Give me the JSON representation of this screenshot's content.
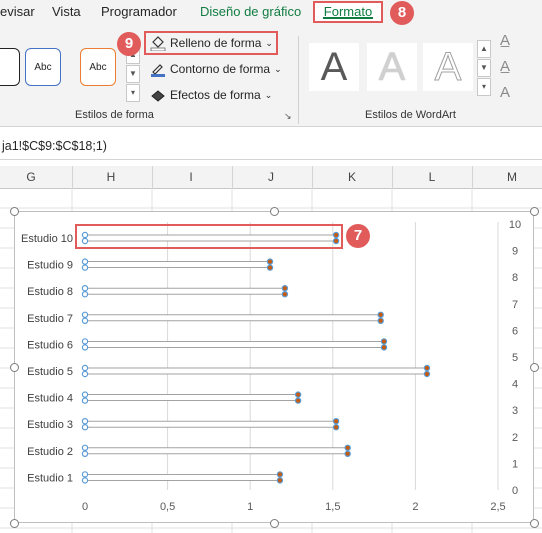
{
  "ribbon": {
    "tabs": [
      {
        "label": "evisar",
        "x": 0
      },
      {
        "label": "Vista",
        "x": 52
      },
      {
        "label": "Programador",
        "x": 101
      },
      {
        "label": "Diseño de gráfico",
        "x": 200
      }
    ],
    "active_tab": "Formato",
    "shape_style_labels": [
      "Abc",
      "Abc"
    ],
    "commands": {
      "fill": "Relleno de forma",
      "outline": "Contorno de forma",
      "effects": "Efectos de forma"
    },
    "group_shape_styles": "Estilos de forma",
    "group_wordart": "Estilos de WordArt",
    "wordart_letter": "A",
    "badges": {
      "fill": "9",
      "tab": "8",
      "chart": "7"
    }
  },
  "formula": "ja1!$C$9:$C$18;1)",
  "columns": [
    "G",
    "H",
    "I",
    "J",
    "K",
    "L",
    "M"
  ],
  "chart_data": {
    "type": "bar",
    "orientation": "horizontal",
    "categories": [
      "Estudio 10",
      "Estudio 9",
      "Estudio 8",
      "Estudio 7",
      "Estudio 6",
      "Estudio 5",
      "Estudio 4",
      "Estudio 3",
      "Estudio 2",
      "Estudio 1"
    ],
    "series": [
      {
        "values": [
          1.52,
          1.12,
          1.21,
          1.79,
          1.81,
          2.07,
          1.29,
          1.52,
          1.59,
          1.18
        ]
      }
    ],
    "x_ticks": [
      "0",
      "0,5",
      "1",
      "1,5",
      "2",
      "2,5"
    ],
    "xlim": [
      0,
      2.5
    ],
    "secondary_y_ticks": [
      "0",
      "1",
      "2",
      "3",
      "4",
      "5",
      "6",
      "7",
      "8",
      "9",
      "10"
    ],
    "secondary_ylim": [
      0,
      10
    ],
    "gridlines": "vertical",
    "colors": {
      "line": "#8c8c8c",
      "marker": "#5b9bd5",
      "marker_fill": "#c55a11",
      "grid": "#d9d9d9",
      "highlight": "#e15b5b"
    }
  }
}
